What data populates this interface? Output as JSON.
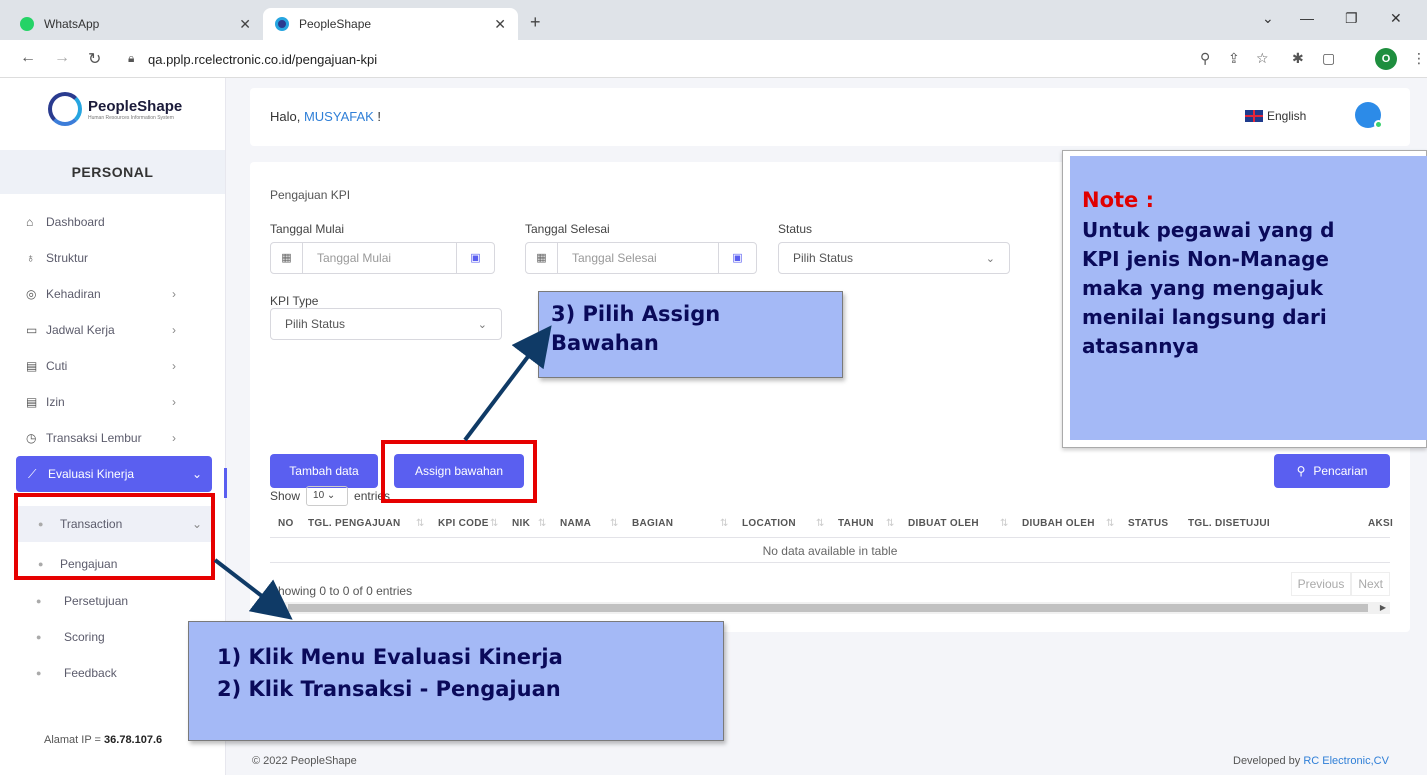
{
  "browser": {
    "tabs": [
      {
        "title": "WhatsApp"
      },
      {
        "title": "PeopleShape"
      }
    ],
    "url": "qa.pplp.rcelectronic.co.id/pengajuan-kpi",
    "profile_initial": "O"
  },
  "sidebar": {
    "brand": "PeopleShape",
    "brand_sub": "Human Resources Information System",
    "section": "PERSONAL",
    "items": [
      {
        "label": "Dashboard"
      },
      {
        "label": "Struktur"
      },
      {
        "label": "Kehadiran"
      },
      {
        "label": "Jadwal Kerja"
      },
      {
        "label": "Cuti"
      },
      {
        "label": "Izin"
      },
      {
        "label": "Transaksi Lembur"
      },
      {
        "label": "Evaluasi Kinerja"
      },
      {
        "label": "Transaction"
      },
      {
        "label": "Pengajuan"
      },
      {
        "label": "Persetujuan"
      },
      {
        "label": "Scoring"
      },
      {
        "label": "Feedback"
      }
    ],
    "ip_label": "Alamat IP  =",
    "ip_value": "36.78.107.6"
  },
  "header": {
    "greeting": "Halo, ",
    "user": "MUSYAFAK",
    "greeting_end": " !",
    "language": "English"
  },
  "form": {
    "title": "Pengajuan KPI",
    "start_label": "Tanggal Mulai",
    "start_placeholder": "Tanggal Mulai",
    "end_label": "Tanggal Selesai",
    "end_placeholder": "Tanggal Selesai",
    "status_label": "Status",
    "status_value": "Pilih Status",
    "kpi_type_label": "KPI Type",
    "kpi_type_value": "Pilih Status",
    "add_button": "Tambah data",
    "assign_button": "Assign bawahan",
    "search_button": "Pencarian"
  },
  "table": {
    "show_label": "Show",
    "show_value": "10",
    "entries_label": "entries",
    "columns": [
      "NO",
      "TGL. PENGAJUAN",
      "KPI CODE",
      "NIK",
      "NAMA",
      "BAGIAN",
      "LOCATION",
      "TAHUN",
      "DIBUAT OLEH",
      "DIUBAH OLEH",
      "STATUS",
      "TGL. DISETUJUI",
      "AKSI"
    ],
    "empty_message": "No data available in table",
    "info": "Showing 0 to 0 of 0 entries",
    "prev": "Previous",
    "next": "Next"
  },
  "footer": {
    "copyright": "© 2022 PeopleShape",
    "dev_prefix": "Developed by ",
    "dev_name": "RC Electronic,CV"
  },
  "annotations": {
    "step3_line1": "3) Pilih Assign",
    "step3_line2": "Bawahan",
    "step1": "1)   Klik Menu Evaluasi Kinerja",
    "step2": "2)   Klik Transaksi - Pengajuan",
    "note_title": "Note :",
    "note_lines": [
      "Untuk pegawai yang d",
      "KPI jenis Non-Manage",
      "maka yang mengajuk",
      "menilai langsung dari",
      "atasannya"
    ]
  },
  "colors": {
    "primary": "#5a5ff0",
    "annotation_red": "#e60000",
    "callout_bg": "#a4b9f6"
  }
}
